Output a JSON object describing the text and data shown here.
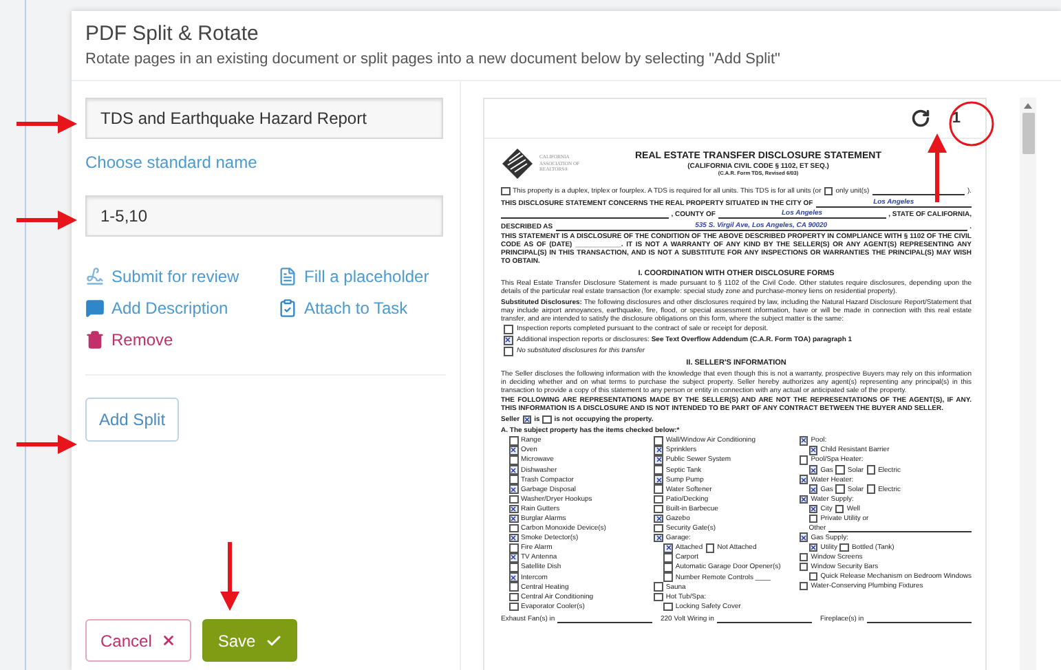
{
  "dialog": {
    "title": "PDF Split & Rotate",
    "subtitle": "Rotate pages in an existing document or split pages into a new document below by selecting \"Add Split\""
  },
  "split": {
    "name_value": "TDS and Earthquake Hazard Report",
    "standard_name_link": "Choose standard name",
    "pages_value": "1-5,10",
    "actions": [
      {
        "kind": "review",
        "label": "Submit for review"
      },
      {
        "kind": "placeholder",
        "label": "Fill a placeholder"
      },
      {
        "kind": "description",
        "label": "Add Description"
      },
      {
        "kind": "task",
        "label": "Attach to Task"
      },
      {
        "kind": "remove",
        "label": "Remove"
      }
    ]
  },
  "add_split_button": "Add Split",
  "buttons": [
    {
      "kind": "cancel",
      "label": "Cancel"
    },
    {
      "kind": "save",
      "label": "Save"
    }
  ],
  "preview": {
    "page_number": "1",
    "document": {
      "logo_text": "CALIFORNIA ASSOCIATION OF REALTORS®",
      "title": "REAL ESTATE TRANSFER DISCLOSURE STATEMENT",
      "subtitle": "(CALIFORNIA CIVIL CODE § 1102, ET SEQ.)",
      "form_note": "(C.A.R. Form TDS, Revised 6/03)",
      "blocks": [
        {
          "kind": "form",
          "parts": [
            {
              "kind": "box",
              "checked": false
            },
            {
              "kind": "text",
              "text": "This property is a duplex, triplex or fourplex.  A TDS is required for all units. This TDS is for all units (or"
            },
            {
              "kind": "box",
              "checked": false
            },
            {
              "kind": "text",
              "text": "only unit(s)"
            },
            {
              "kind": "blank"
            },
            {
              "kind": "text",
              "text": ")."
            }
          ]
        },
        {
          "kind": "form",
          "bold": true,
          "parts": [
            {
              "kind": "text",
              "text": "THIS DISCLOSURE STATEMENT CONCERNS THE REAL PROPERTY SITUATED IN THE CITY OF"
            },
            {
              "kind": "fill",
              "text": "Los Angeles"
            }
          ]
        },
        {
          "kind": "form",
          "bold": true,
          "parts": [
            {
              "kind": "blank"
            },
            {
              "kind": "text",
              "text": ", COUNTY OF"
            },
            {
              "kind": "fill",
              "text": "Los Angeles"
            },
            {
              "kind": "text",
              "text": ", STATE OF CALIFORNIA,"
            }
          ]
        },
        {
          "kind": "form",
          "bold": true,
          "parts": [
            {
              "kind": "text",
              "text": "DESCRIBED AS"
            },
            {
              "kind": "fill",
              "text": "535 S. Virgil Ave, Los Angeles, CA  90020"
            },
            {
              "kind": "text",
              "text": "."
            }
          ]
        },
        {
          "kind": "bold",
          "text": "THIS STATEMENT IS A DISCLOSURE OF THE CONDITION OF THE ABOVE DESCRIBED PROPERTY IN COMPLIANCE WITH § 1102 OF THE CIVIL CODE AS OF (DATE) ____________. IT IS NOT A WARRANTY OF ANY KIND BY THE SELLER(S) OR ANY AGENT(S) REPRESENTING ANY PRINCIPAL(S) IN THIS TRANSACTION, AND IS NOT A SUBSTITUTE FOR ANY INSPECTIONS OR WARRANTIES THE PRINCIPAL(S) MAY WISH TO OBTAIN."
        },
        {
          "kind": "heading",
          "text": "I. COORDINATION WITH OTHER DISCLOSURE FORMS"
        },
        {
          "kind": "para",
          "text": "This Real Estate Transfer Disclosure Statement is made pursuant to § 1102 of the Civil Code. Other statutes require disclosures, depending upon the details of the particular real estate transaction (for example: special study zone and purchase-money liens on residential property)."
        },
        {
          "kind": "para",
          "text": "**Substituted Disclosures:** The following disclosures and other disclosures required by law, including the Natural Hazard Disclosure Report/Statement that may include airport annoyances, earthquake, fire, flood, or special assessment information, have or will be made in connection with this real estate transfer, and are intended to satisfy the disclosure obligations on this form, where the subject matter is the same:"
        },
        {
          "kind": "check",
          "checked": false,
          "text": "Inspection reports completed pursuant to the contract of sale or receipt for deposit."
        },
        {
          "kind": "check",
          "checked": true,
          "text": "Additional inspection reports or disclosures: **See Text Overflow Addendum (C.A.R. Form TOA) paragraph 1**"
        },
        {
          "kind": "check",
          "checked": false,
          "italic": true,
          "text": "No substituted disclosures for this transfer"
        },
        {
          "kind": "heading",
          "text": "II. SELLER'S INFORMATION"
        },
        {
          "kind": "para",
          "text": "The Seller discloses the following information with the knowledge that even though this is not a warranty, prospective Buyers may rely on this information in deciding whether and on what terms to purchase the subject property. Seller hereby authorizes any agent(s) representing any principal(s) in this transaction to provide a copy of this statement to any person or entity in connection with any actual or anticipated sale of the property."
        },
        {
          "kind": "bold",
          "text": "THE FOLLOWING ARE REPRESENTATIONS MADE BY THE SELLER(S) AND ARE NOT THE REPRESENTATIONS OF THE AGENT(S), IF ANY. THIS INFORMATION IS A DISCLOSURE AND IS NOT INTENDED TO BE PART OF ANY CONTRACT BETWEEN THE BUYER AND SELLER."
        },
        {
          "kind": "form",
          "bold": true,
          "parts": [
            {
              "kind": "text",
              "text": "Seller"
            },
            {
              "kind": "box",
              "checked": true
            },
            {
              "kind": "text",
              "text": "is"
            },
            {
              "kind": "box",
              "checked": false
            },
            {
              "kind": "text",
              "text": "is not"
            },
            {
              "kind": "text",
              "text": "occupying the property."
            }
          ]
        },
        {
          "kind": "bold",
          "text": "A.   The subject property has the items checked below:*"
        },
        {
          "kind": "checklist",
          "columns": [
            [
              {
                "boxes": [
                  {
                    "label": "Range",
                    "checked": false
                  }
                ]
              },
              {
                "boxes": [
                  {
                    "label": "Oven",
                    "checked": true
                  }
                ]
              },
              {
                "boxes": [
                  {
                    "label": "Microwave",
                    "checked": false
                  }
                ]
              },
              {
                "boxes": [
                  {
                    "label": "Dishwasher",
                    "checked": true
                  }
                ]
              },
              {
                "boxes": [
                  {
                    "label": "Trash Compactor",
                    "checked": false
                  }
                ]
              },
              {
                "boxes": [
                  {
                    "label": "Garbage Disposal",
                    "checked": true
                  }
                ]
              },
              {
                "boxes": [
                  {
                    "label": "Washer/Dryer Hookups",
                    "checked": false
                  }
                ]
              },
              {
                "boxes": [
                  {
                    "label": "Rain Gutters",
                    "checked": true
                  }
                ]
              },
              {
                "boxes": [
                  {
                    "label": "Burglar Alarms",
                    "checked": true
                  }
                ]
              },
              {
                "boxes": [
                  {
                    "label": "Carbon Monoxide Device(s)",
                    "checked": false
                  }
                ]
              },
              {
                "boxes": [
                  {
                    "label": "Smoke Detector(s)",
                    "checked": true
                  }
                ]
              },
              {
                "boxes": [
                  {
                    "label": "Fire Alarm",
                    "checked": false
                  }
                ]
              },
              {
                "boxes": [
                  {
                    "label": "TV Antenna",
                    "checked": true
                  }
                ]
              },
              {
                "boxes": [
                  {
                    "label": "Satellite Dish",
                    "checked": false
                  }
                ]
              },
              {
                "boxes": [
                  {
                    "label": "Intercom",
                    "checked": true
                  }
                ]
              },
              {
                "boxes": [
                  {
                    "label": "Central Heating",
                    "checked": false
                  }
                ]
              },
              {
                "boxes": [
                  {
                    "label": "Central Air Conditioning",
                    "checked": false
                  }
                ]
              },
              {
                "boxes": [
                  {
                    "label": "Evaporator Cooler(s)",
                    "checked": false
                  }
                ]
              }
            ],
            [
              {
                "boxes": [
                  {
                    "label": "Wall/Window Air Conditioning",
                    "checked": false
                  }
                ]
              },
              {
                "boxes": [
                  {
                    "label": "Sprinklers",
                    "checked": true
                  }
                ]
              },
              {
                "boxes": [
                  {
                    "label": "Public Sewer System",
                    "checked": true
                  }
                ]
              },
              {
                "boxes": [
                  {
                    "label": "Septic Tank",
                    "checked": false
                  }
                ]
              },
              {
                "boxes": [
                  {
                    "label": "Sump Pump",
                    "checked": true
                  }
                ]
              },
              {
                "boxes": [
                  {
                    "label": "Water Softener",
                    "checked": false
                  }
                ]
              },
              {
                "boxes": [
                  {
                    "label": "Patio/Decking",
                    "checked": false
                  }
                ]
              },
              {
                "boxes": [
                  {
                    "label": "Built-in Barbecue",
                    "checked": false
                  }
                ]
              },
              {
                "boxes": [
                  {
                    "label": "Gazebo",
                    "checked": true
                  }
                ]
              },
              {
                "boxes": [
                  {
                    "label": "Security Gate(s)",
                    "checked": false
                  }
                ]
              },
              {
                "boxes": [
                  {
                    "label": "Garage:",
                    "checked": true
                  }
                ],
                "children": [
                  {
                    "boxes": [
                      {
                        "label": "Attached",
                        "checked": true
                      },
                      {
                        "label": "Not Attached",
                        "checked": false
                      }
                    ]
                  },
                  {
                    "boxes": [
                      {
                        "label": "Carport",
                        "checked": false
                      }
                    ]
                  },
                  {
                    "boxes": [
                      {
                        "label": "Automatic Garage Door Opener(s)",
                        "checked": false
                      }
                    ]
                  },
                  {
                    "boxes": [
                      {
                        "label": "Number Remote Controls ____",
                        "checked": false
                      }
                    ]
                  }
                ]
              },
              {
                "boxes": [
                  {
                    "label": "Sauna",
                    "checked": false
                  }
                ]
              },
              {
                "boxes": [
                  {
                    "label": "Hot Tub/Spa:",
                    "checked": false
                  }
                ],
                "children": [
                  {
                    "boxes": [
                      {
                        "label": "Locking Safety Cover",
                        "checked": false
                      }
                    ]
                  }
                ]
              }
            ],
            [
              {
                "boxes": [
                  {
                    "label": "Pool:",
                    "checked": true
                  }
                ],
                "children": [
                  {
                    "boxes": [
                      {
                        "label": "Child Resistant Barrier",
                        "checked": true
                      }
                    ]
                  }
                ]
              },
              {
                "boxes": [
                  {
                    "label": "Pool/Spa Heater:",
                    "checked": false
                  }
                ],
                "children": [
                  {
                    "boxes": [
                      {
                        "label": "Gas",
                        "checked": true
                      },
                      {
                        "label": "Solar",
                        "checked": false
                      },
                      {
                        "label": "Electric",
                        "checked": false
                      }
                    ]
                  }
                ]
              },
              {
                "boxes": [
                  {
                    "label": "Water Heater:",
                    "checked": true
                  }
                ],
                "children": [
                  {
                    "boxes": [
                      {
                        "label": "Gas",
                        "checked": true
                      },
                      {
                        "label": "Solar",
                        "checked": false
                      },
                      {
                        "label": "Electric",
                        "checked": false
                      }
                    ]
                  }
                ]
              },
              {
                "boxes": [
                  {
                    "label": "Water Supply:",
                    "checked": true
                  }
                ],
                "children": [
                  {
                    "boxes": [
                      {
                        "label": "City",
                        "checked": true
                      },
                      {
                        "label": "Well",
                        "checked": false
                      }
                    ]
                  },
                  {
                    "boxes": [
                      {
                        "label": "Private Utility or",
                        "checked": false
                      }
                    ]
                  },
                  {
                    "text": "Other"
                  }
                ]
              },
              {
                "boxes": [
                  {
                    "label": "Gas Supply:",
                    "checked": true
                  }
                ],
                "children": [
                  {
                    "boxes": [
                      {
                        "label": "Utility",
                        "checked": true
                      },
                      {
                        "label": "Bottled (Tank)",
                        "checked": false
                      }
                    ]
                  }
                ]
              },
              {
                "boxes": [
                  {
                    "label": "Window Screens",
                    "checked": false
                  }
                ]
              },
              {
                "boxes": [
                  {
                    "label": "Window Security Bars",
                    "checked": false
                  }
                ],
                "children": [
                  {
                    "boxes": [
                      {
                        "label": "Quick Release Mechanism on Bedroom Windows",
                        "checked": false
                      }
                    ]
                  }
                ]
              },
              {
                "boxes": [
                  {
                    "label": "Water-Conserving Plumbing Fixtures",
                    "checked": false
                  }
                ]
              }
            ]
          ]
        },
        {
          "kind": "blanks",
          "items": [
            "Exhaust Fan(s) in",
            "220 Volt Wiring in",
            "Fireplace(s) in"
          ]
        }
      ]
    }
  }
}
